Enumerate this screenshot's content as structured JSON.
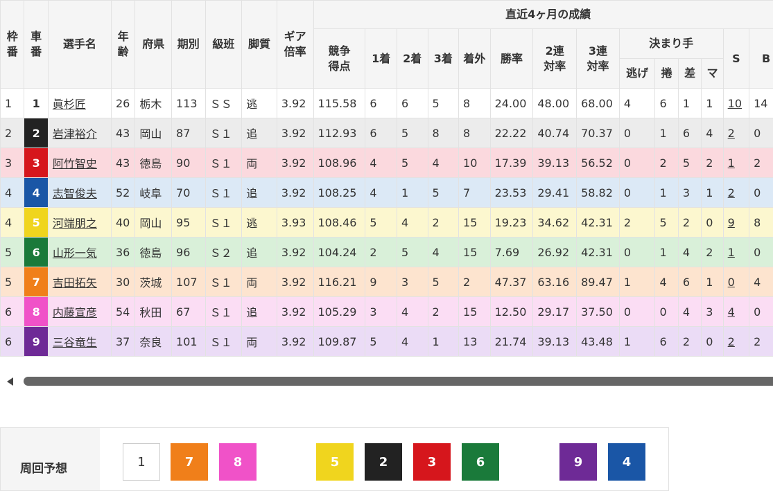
{
  "header": {
    "waku": "枠番",
    "sha": "車番",
    "name": "選手名",
    "age": "年齢",
    "pref": "府県",
    "term": "期別",
    "class": "級班",
    "leg": "脚質",
    "gear": "ギア倍率",
    "recent": "直近4ヶ月の成績",
    "score": "競争得点",
    "first": "1着",
    "second": "2着",
    "third": "3着",
    "out": "着外",
    "win_rate": "勝率",
    "ren2": "2連対率",
    "ren3": "3連対率",
    "kimarite": "決まり手",
    "nige": "逃げ",
    "makuri": "捲",
    "sashi": "差",
    "mark": "マ",
    "s": "S",
    "b": "B"
  },
  "colors": {
    "car": {
      "1": {
        "bg": "#ffffff",
        "fg": "#333333"
      },
      "2": {
        "bg": "#222222",
        "fg": "#ffffff"
      },
      "3": {
        "bg": "#d6161c",
        "fg": "#ffffff"
      },
      "4": {
        "bg": "#1a56a6",
        "fg": "#ffffff"
      },
      "5": {
        "bg": "#f0d51e",
        "fg": "#ffffff"
      },
      "6": {
        "bg": "#1a7a3a",
        "fg": "#ffffff"
      },
      "7": {
        "bg": "#f07f1a",
        "fg": "#ffffff"
      },
      "8": {
        "bg": "#f052c8",
        "fg": "#ffffff"
      },
      "9": {
        "bg": "#6e2a96",
        "fg": "#ffffff"
      }
    },
    "row": {
      "1": "#ffffff",
      "2": "#ececec",
      "3": "#fbd9de",
      "4": "#dce9f6",
      "5": "#fcf7cf",
      "6": "#d9f0d9",
      "7": "#fde4cf",
      "8": "#fbddf4",
      "9": "#ebdcf6"
    }
  },
  "rows": [
    {
      "waku": "1",
      "car": "1",
      "name": "眞杉匠",
      "age": "26",
      "pref": "栃木",
      "term": "113",
      "class": "ＳＳ",
      "leg": "逃",
      "gear": "3.92",
      "score": "115.58",
      "first": "6",
      "second": "6",
      "third": "5",
      "out": "8",
      "win": "24.00",
      "ren2": "48.00",
      "ren3": "68.00",
      "nige": "4",
      "makuri": "6",
      "sashi": "1",
      "mark": "1",
      "s": "10",
      "b": "14"
    },
    {
      "waku": "2",
      "car": "2",
      "name": "岩津裕介",
      "age": "43",
      "pref": "岡山",
      "term": "87",
      "class": "Ｓ１",
      "leg": "追",
      "gear": "3.92",
      "score": "112.93",
      "first": "6",
      "second": "5",
      "third": "8",
      "out": "8",
      "win": "22.22",
      "ren2": "40.74",
      "ren3": "70.37",
      "nige": "0",
      "makuri": "1",
      "sashi": "6",
      "mark": "4",
      "s": "2",
      "b": "0"
    },
    {
      "waku": "3",
      "car": "3",
      "name": "阿竹智史",
      "age": "43",
      "pref": "徳島",
      "term": "90",
      "class": "Ｓ１",
      "leg": "両",
      "gear": "3.92",
      "score": "108.96",
      "first": "4",
      "second": "5",
      "third": "4",
      "out": "10",
      "win": "17.39",
      "ren2": "39.13",
      "ren3": "56.52",
      "nige": "0",
      "makuri": "2",
      "sashi": "5",
      "mark": "2",
      "s": "1",
      "b": "2"
    },
    {
      "waku": "4",
      "car": "4",
      "name": "志智俊夫",
      "age": "52",
      "pref": "岐阜",
      "term": "70",
      "class": "Ｓ１",
      "leg": "追",
      "gear": "3.92",
      "score": "108.25",
      "first": "4",
      "second": "1",
      "third": "5",
      "out": "7",
      "win": "23.53",
      "ren2": "29.41",
      "ren3": "58.82",
      "nige": "0",
      "makuri": "1",
      "sashi": "3",
      "mark": "1",
      "s": "2",
      "b": "0"
    },
    {
      "waku": "4",
      "car": "5",
      "name": "河端朋之",
      "age": "40",
      "pref": "岡山",
      "term": "95",
      "class": "Ｓ１",
      "leg": "逃",
      "gear": "3.93",
      "score": "108.46",
      "first": "5",
      "second": "4",
      "third": "2",
      "out": "15",
      "win": "19.23",
      "ren2": "34.62",
      "ren3": "42.31",
      "nige": "2",
      "makuri": "5",
      "sashi": "2",
      "mark": "0",
      "s": "9",
      "b": "8"
    },
    {
      "waku": "5",
      "car": "6",
      "name": "山形一気",
      "age": "36",
      "pref": "徳島",
      "term": "96",
      "class": "Ｓ２",
      "leg": "追",
      "gear": "3.92",
      "score": "104.24",
      "first": "2",
      "second": "5",
      "third": "4",
      "out": "15",
      "win": "7.69",
      "ren2": "26.92",
      "ren3": "42.31",
      "nige": "0",
      "makuri": "1",
      "sashi": "4",
      "mark": "2",
      "s": "1",
      "b": "0"
    },
    {
      "waku": "5",
      "car": "7",
      "name": "吉田拓矢",
      "age": "30",
      "pref": "茨城",
      "term": "107",
      "class": "Ｓ１",
      "leg": "両",
      "gear": "3.92",
      "score": "116.21",
      "first": "9",
      "second": "3",
      "third": "5",
      "out": "2",
      "win": "47.37",
      "ren2": "63.16",
      "ren3": "89.47",
      "nige": "1",
      "makuri": "4",
      "sashi": "6",
      "mark": "1",
      "s": "0",
      "b": "4"
    },
    {
      "waku": "6",
      "car": "8",
      "name": "内藤宣彦",
      "age": "54",
      "pref": "秋田",
      "term": "67",
      "class": "Ｓ１",
      "leg": "追",
      "gear": "3.92",
      "score": "105.29",
      "first": "3",
      "second": "4",
      "third": "2",
      "out": "15",
      "win": "12.50",
      "ren2": "29.17",
      "ren3": "37.50",
      "nige": "0",
      "makuri": "0",
      "sashi": "4",
      "mark": "3",
      "s": "4",
      "b": "0"
    },
    {
      "waku": "6",
      "car": "9",
      "name": "三谷竜生",
      "age": "37",
      "pref": "奈良",
      "term": "101",
      "class": "Ｓ１",
      "leg": "両",
      "gear": "3.92",
      "score": "109.87",
      "first": "5",
      "second": "4",
      "third": "1",
      "out": "13",
      "win": "21.74",
      "ren2": "39.13",
      "ren3": "43.48",
      "nige": "1",
      "makuri": "6",
      "sashi": "2",
      "mark": "0",
      "s": "2",
      "b": "2"
    }
  ],
  "scrollbar": {
    "left_arrow_icon": "triangle-left-icon"
  },
  "forecast": {
    "label": "周回予想",
    "items": [
      {
        "car": "1"
      },
      {
        "car": "7"
      },
      {
        "car": "8"
      },
      {
        "car": ""
      },
      {
        "car": "5"
      },
      {
        "car": "2"
      },
      {
        "car": "3"
      },
      {
        "car": "6"
      },
      {
        "car": ""
      },
      {
        "car": "9"
      },
      {
        "car": "4"
      }
    ]
  }
}
